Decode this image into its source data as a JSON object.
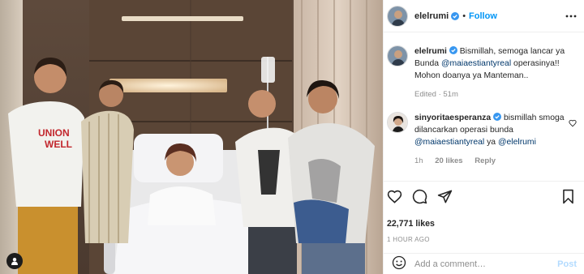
{
  "post": {
    "username": "elelrumi",
    "follow_label": "Follow",
    "dot": "•"
  },
  "caption": {
    "username": "elelrumi",
    "text_1": "Bismillah, semoga lancar ya Bunda ",
    "mention": "@maiaestiantyreal",
    "text_2": " operasinya!! Mohon doanya ya Manteman..",
    "meta": "Edited · 51m"
  },
  "comment": {
    "username": "sinyoritaesperanza",
    "text_1": "bismillah smoga dilancarkan operasi bunda ",
    "mention_1": "@maiaestiantyreal",
    "text_2": " ya ",
    "mention_2": "@elelrumi",
    "time": "1h",
    "likes": "20 likes",
    "reply": "Reply"
  },
  "stats": {
    "likes": "22,771 likes",
    "posted": "1 HOUR AGO"
  },
  "add_comment": {
    "placeholder": "Add a comment…",
    "post_label": "Post"
  },
  "colors": {
    "accent": "#0095f6",
    "verified": "#3897f0",
    "muted": "#8e8e8e",
    "mention": "#00376b"
  },
  "icons": [
    "verified-icon",
    "more-icon",
    "heart-icon",
    "comment-icon",
    "share-icon",
    "bookmark-icon",
    "emoji-icon",
    "user-tag-icon"
  ]
}
